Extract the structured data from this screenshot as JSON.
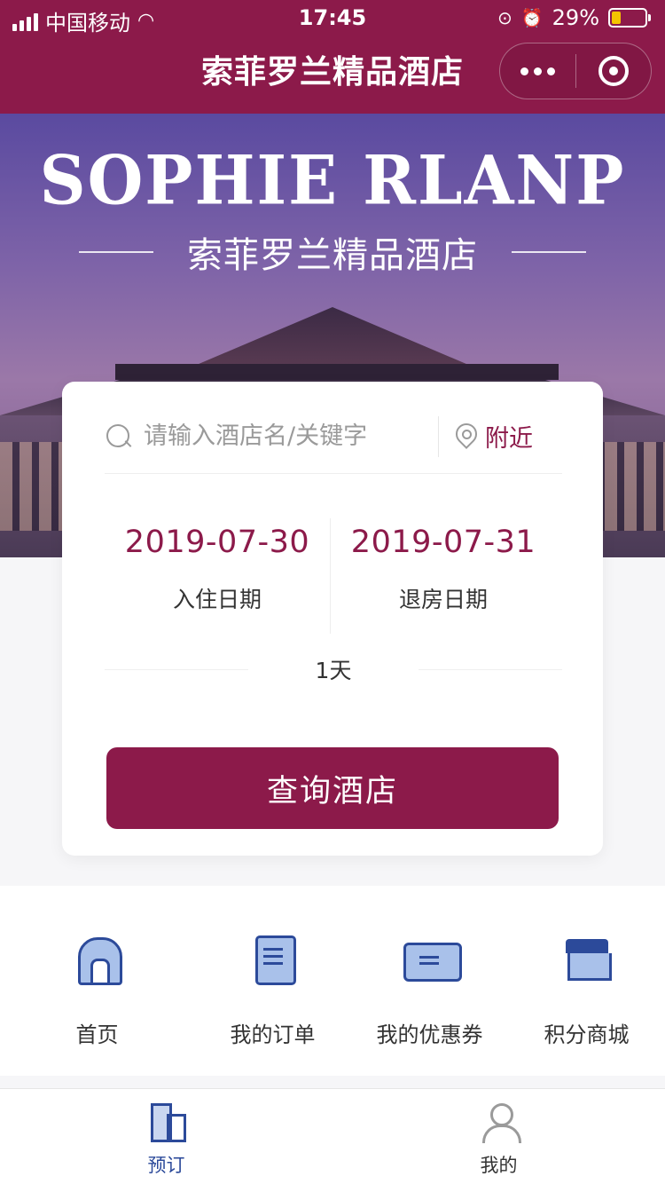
{
  "status_bar": {
    "carrier": "中国移动",
    "time": "17:45",
    "battery": "29%",
    "battery_level": 0.29,
    "icons": [
      "signal-icon",
      "wifi-icon",
      "lock-rotation-icon",
      "alarm-icon",
      "battery-icon"
    ]
  },
  "title_bar": {
    "title": "索菲罗兰精品酒店",
    "icons": [
      "more-icon",
      "close-target-icon"
    ]
  },
  "banner": {
    "title_en": "SOPHIE RLANP",
    "title_cn": "索菲罗兰精品酒店"
  },
  "search": {
    "placeholder": "请输入酒店名/关键字",
    "nearby_label": "附近",
    "checkin_date": "2019-07-30",
    "checkin_label": "入住日期",
    "checkout_date": "2019-07-31",
    "checkout_label": "退房日期",
    "nights": "1天",
    "query_button": "查询酒店"
  },
  "menu": {
    "items": [
      {
        "label": "首页",
        "icon": "home-icon"
      },
      {
        "label": "我的订单",
        "icon": "order-icon"
      },
      {
        "label": "我的优惠券",
        "icon": "coupon-icon"
      },
      {
        "label": "积分商城",
        "icon": "mall-icon"
      }
    ]
  },
  "tabbar": {
    "tabs": [
      {
        "label": "预订",
        "icon": "booking-icon",
        "active": true
      },
      {
        "label": "我的",
        "icon": "user-icon",
        "active": false
      }
    ]
  },
  "colors": {
    "brand": "#8c1a4a",
    "icon_blue": "#2c4a9a",
    "icon_fill": "#a9c1ea"
  }
}
